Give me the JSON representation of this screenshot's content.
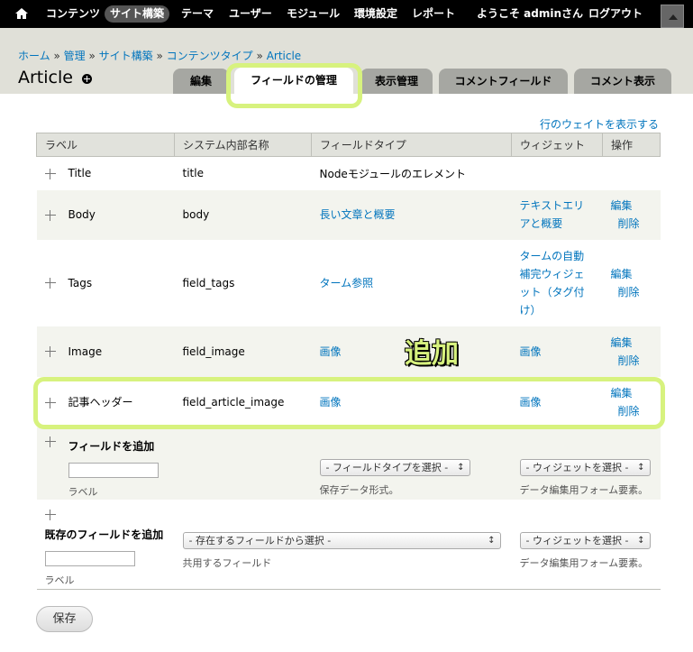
{
  "toolbar": {
    "items": [
      "コンテンツ",
      "サイト構築",
      "テーマ",
      "ユーザー",
      "モジュール",
      "環境設定",
      "レポート"
    ],
    "welcome": "ようこそ adminさん",
    "logout": "ログアウト"
  },
  "breadcrumb": {
    "home": "ホーム",
    "admin": "管理",
    "structure": "サイト構築",
    "content_types": "コンテンツタイプ",
    "article": "Article",
    "sep": "»"
  },
  "page_title": "Article",
  "tabs": [
    "編集",
    "フィールドの管理",
    "表示管理",
    "コメントフィールド",
    "コメント表示"
  ],
  "row_weights_link": "行のウェイトを表示する",
  "table": {
    "headers": [
      "ラベル",
      "システム内部名称",
      "フィールドタイプ",
      "ウィジェット",
      "操作"
    ],
    "rows": [
      {
        "label": "Title",
        "machine": "title",
        "type": "Nodeモジュールのエレメント",
        "widget": "",
        "edit": "",
        "delete": ""
      },
      {
        "label": "Body",
        "machine": "body",
        "type": "長い文章と概要",
        "widget": "テキストエリアと概要",
        "edit": "編集",
        "delete": "削除"
      },
      {
        "label": "Tags",
        "machine": "field_tags",
        "type": "ターム参照",
        "widget": "タームの自動補完ウィジェット（タグ付け）",
        "edit": "編集",
        "delete": "削除"
      },
      {
        "label": "Image",
        "machine": "field_image",
        "type": "画像",
        "widget": "画像",
        "edit": "編集",
        "delete": "削除"
      },
      {
        "label": "記事ヘッダー",
        "machine": "field_article_image",
        "type": "画像",
        "widget": "画像",
        "edit": "編集",
        "delete": "削除"
      }
    ],
    "add_new": {
      "title": "フィールドを追加",
      "label_desc": "ラベル",
      "type_select": "- フィールドタイプを選択 -",
      "type_desc": "保存データ形式。",
      "widget_select": "- ウィジェットを選択 -",
      "widget_desc": "データ編集用フォーム要素。"
    },
    "add_existing": {
      "title": "既存のフィールドを追加",
      "label_desc": "ラベル",
      "field_select": "- 存在するフィールドから選択 -",
      "field_desc": "共用するフィールド",
      "widget_select": "- ウィジェットを選択 -",
      "widget_desc": "データ編集用フォーム要素。"
    }
  },
  "annotation": "追加",
  "save_label": "保存",
  "colors": {
    "highlight": "#d7f27e",
    "link": "#0074bd",
    "toolbar": "#000000"
  }
}
